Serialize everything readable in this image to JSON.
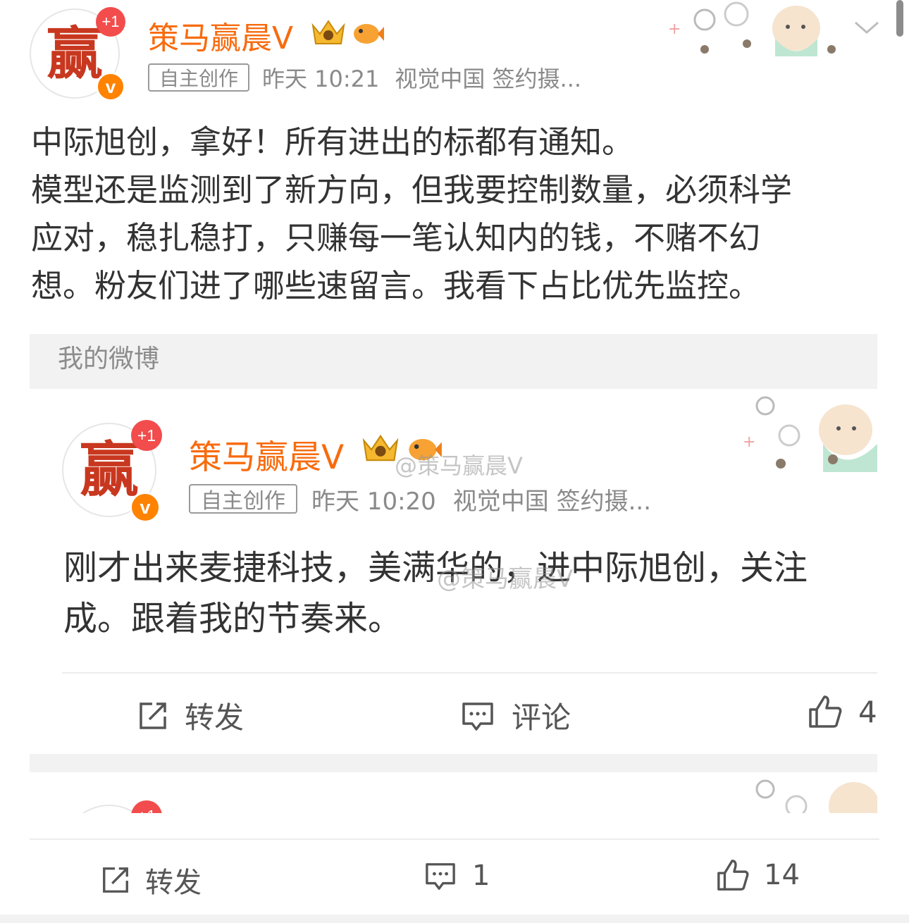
{
  "post": {
    "author": "策马赢晨V",
    "avatar_char": "赢",
    "plus_badge": "+1",
    "verified_badge": "v",
    "tag": "自主创作",
    "time": "昨天 10:21",
    "source": "视觉中国 签约摄...",
    "text": "中际旭创，拿好！所有进出的标都有通知。\n模型还是监测到了新方向，但我要控制数量，必须科学\n应对，稳扎稳打，只赚每一笔认知内的钱，不赌不幻\n想。粉友们进了哪些速留言。我看下占比优先监控。"
  },
  "quoted_section": {
    "header": "我的微博",
    "author": "策马赢晨V",
    "avatar_char": "赢",
    "plus_badge": "+1",
    "verified_badge": "v",
    "tag": "自主创作",
    "time": "昨天 10:20",
    "source": "视觉中国 签约摄...",
    "text": "刚才出来麦捷科技，美满华的，进中际旭创，关注\n成。跟着我的节奏来。",
    "watermark": "@策马赢晨V",
    "actions": {
      "repost": "转发",
      "comment": "评论",
      "like_count": "4"
    }
  },
  "third_card": {
    "plus_badge": "+1"
  },
  "bottom_bar": {
    "repost": "转发",
    "comment_count": "1",
    "like_count": "14"
  },
  "icons": {
    "repost": "repost-icon",
    "comment": "comment-icon",
    "like": "like-icon",
    "dropdown": "chevron-down-icon"
  },
  "colors": {
    "username": "#f86b0e",
    "verified": "#ff8200",
    "badge_red": "#f24c4c",
    "section_bg": "#f2f2f2"
  }
}
